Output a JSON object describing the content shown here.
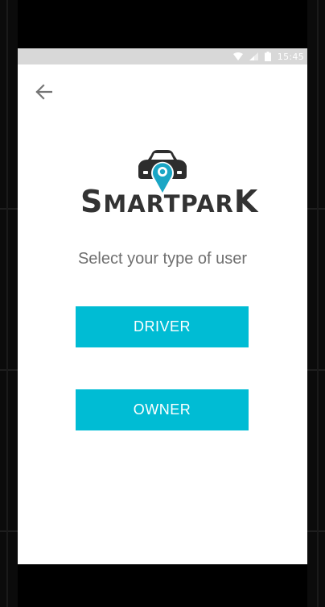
{
  "status_bar": {
    "time": "15:45",
    "icons": [
      "wifi-icon",
      "signal-icon",
      "battery-icon"
    ]
  },
  "header": {
    "back_icon": "arrow-left-icon"
  },
  "logo": {
    "text_first_letter": "S",
    "text_middle": "MARTPAR",
    "text_last_letter": "K",
    "icon": "car-location-pin-icon"
  },
  "main": {
    "prompt": "Select your type of user",
    "driver_label": "DRIVER",
    "owner_label": "OWNER"
  },
  "colors": {
    "accent": "#00bcd4",
    "logo_text": "#333333",
    "prompt_text": "#6f6f6f",
    "status_bar": "#d8d8d8"
  }
}
